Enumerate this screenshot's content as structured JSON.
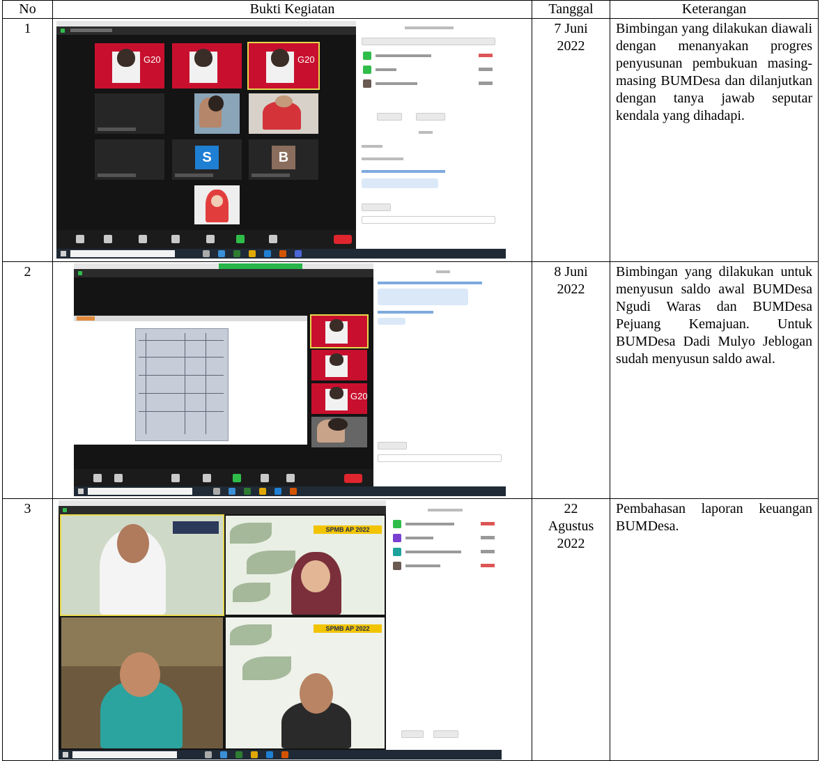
{
  "headers": {
    "no": "No",
    "bukti": "Bukti Kegiatan",
    "tanggal": "Tanggal",
    "keterangan": "Keterangan"
  },
  "rows": [
    {
      "no": "1",
      "tanggal_lines": [
        "7 Juni",
        "2022"
      ],
      "keterangan": "Bimbingan yang dilakukan diawali dengan menanyakan progres penyusunan pembukuan masing-masing BUMDesa dan dilanjutkan dengan tanya jawab seputar kendala yang dihadapi.",
      "shot": {
        "avatar_s": "S",
        "avatar_b": "B",
        "logo": "G20"
      }
    },
    {
      "no": "2",
      "tanggal_lines": [
        "8 Juni",
        "2022"
      ],
      "keterangan": "Bimbingan yang dilakukan untuk menyusun saldo awal BUMDesa Ngudi Waras dan BUMDesa Pejuang Kemajuan. Untuk BUMDesa Dadi Mulyo Jeblogan sudah menyusun saldo awal.",
      "shot": {
        "logo": "G20"
      }
    },
    {
      "no": "3",
      "tanggal_lines": [
        "22",
        "Agustus",
        "2022"
      ],
      "keterangan": "Pembahasan laporan keuangan BUMDesa.",
      "shot": {
        "banner": "SPMB AP 2022"
      }
    }
  ]
}
